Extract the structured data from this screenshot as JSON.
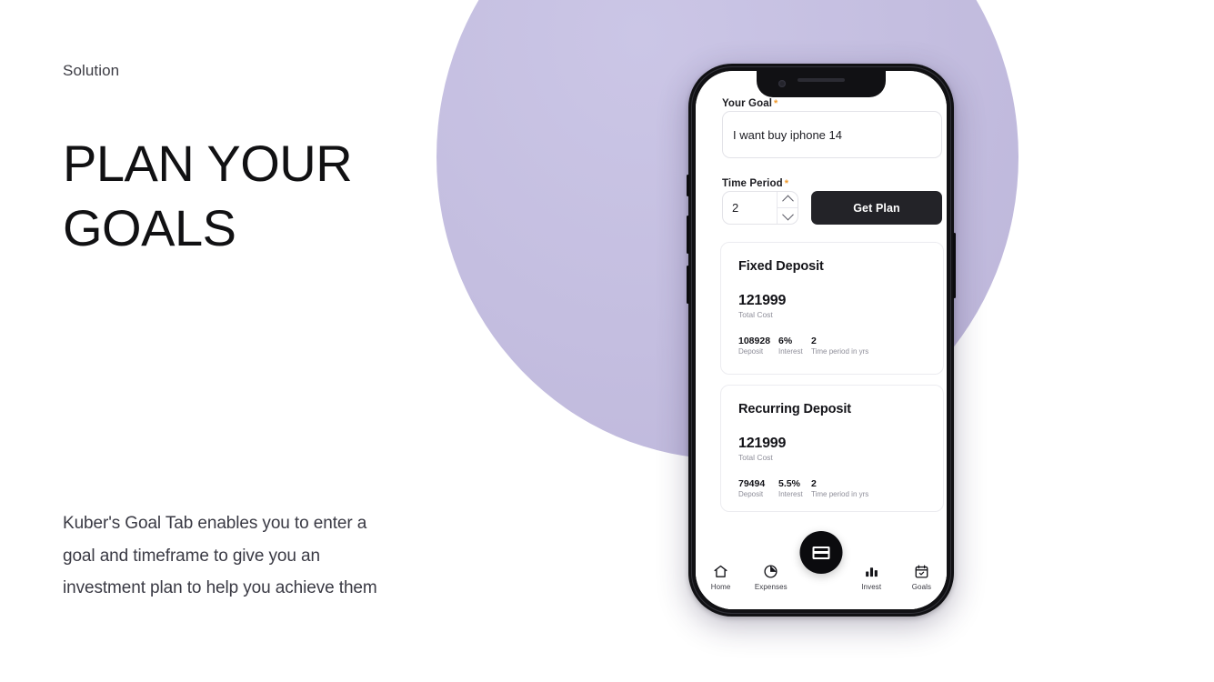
{
  "left": {
    "eyebrow": "Solution",
    "headline": "PLAN YOUR GOALS",
    "body": "Kuber's Goal Tab enables you to enter a goal and timeframe to give you an investment plan to help you achieve them"
  },
  "colors": {
    "blob_purple": "#c3bddf",
    "dark": "#232328",
    "required_asterisk": "#f09a2c",
    "muted_text": "#8e8e99"
  },
  "phone": {
    "form": {
      "goal_label": "Your Goal",
      "goal_required_mark": "*",
      "goal_value": "I want buy iphone 14",
      "goal_placeholder": "I want buy iphone 14",
      "time_label": "Time Period",
      "time_required_mark": "*",
      "time_value": "2",
      "spinner_up_icon": "chevron-up-icon",
      "spinner_down_icon": "chevron-down-icon",
      "submit_label": "Get Plan"
    },
    "results": [
      {
        "title": "Fixed Deposit",
        "total_value": "121999",
        "total_caption": "Total Cost",
        "metrics": [
          {
            "value": "108928",
            "caption": "Deposit"
          },
          {
            "value": "6%",
            "caption": "Interest"
          },
          {
            "value": "2",
            "caption": "Time period in yrs"
          }
        ]
      },
      {
        "title": "Recurring Deposit",
        "total_value": "121999",
        "total_caption": "Total Cost",
        "metrics": [
          {
            "value": "79494",
            "caption": "Deposit"
          },
          {
            "value": "5.5%",
            "caption": "Interest"
          },
          {
            "value": "2",
            "caption": "Time period in yrs"
          }
        ]
      }
    ],
    "bottom_nav": {
      "items": [
        {
          "label": "Home",
          "icon": "home-icon"
        },
        {
          "label": "Expenses",
          "icon": "pie-chart-icon"
        },
        {
          "label": "Invest",
          "icon": "bar-chart-icon"
        },
        {
          "label": "Goals",
          "icon": "calendar-check-icon"
        }
      ],
      "fab_icon": "card-stack-icon"
    }
  }
}
